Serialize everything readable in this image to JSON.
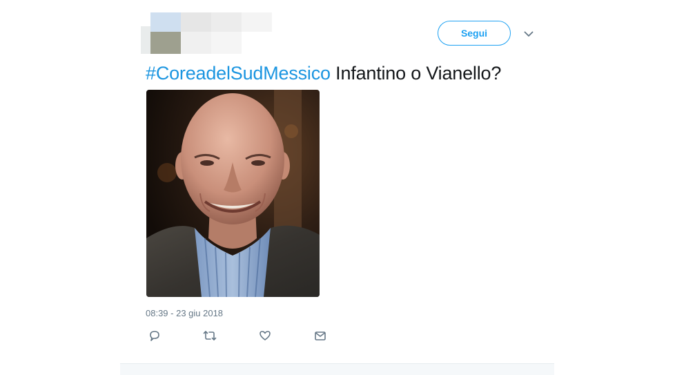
{
  "tweet": {
    "follow_label": "Segui",
    "hashtag": "#CoreadelSudMessico",
    "text": " Infantino o Vianello?",
    "timestamp": "08:39 - 23 giu 2018"
  },
  "icons": {
    "reply": "speech-bubble-icon",
    "retweet": "retweet-icon",
    "like": "heart-icon",
    "dm": "envelope-icon",
    "menu": "chevron-down-icon"
  },
  "colors": {
    "accent": "#1da1f2",
    "hashtag": "#1b95e0",
    "text": "#14171a",
    "muted": "#657786"
  }
}
